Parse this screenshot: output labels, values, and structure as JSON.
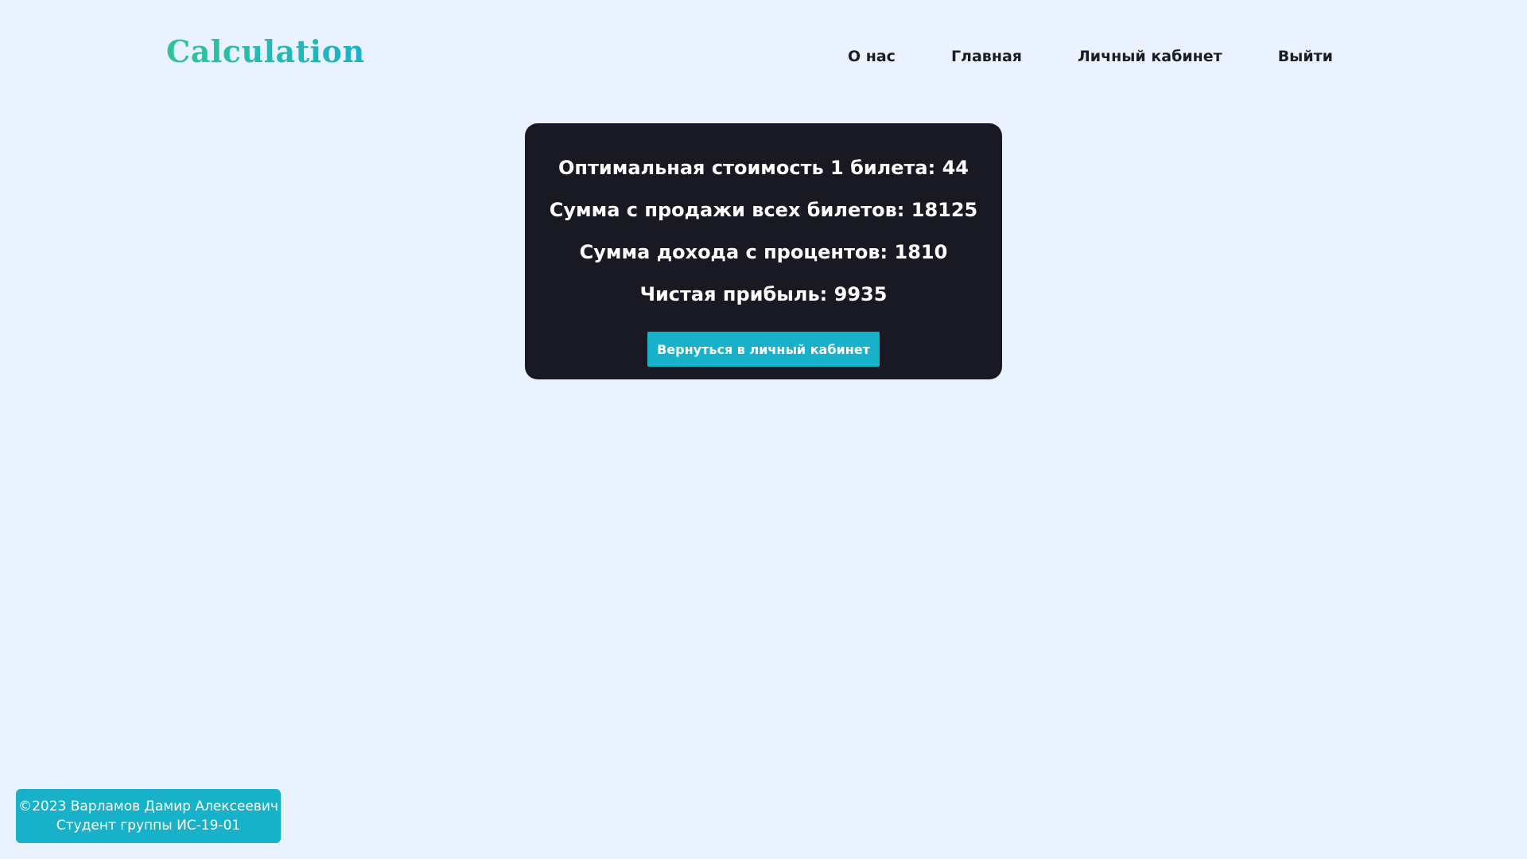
{
  "header": {
    "logo": "Calculation",
    "nav": [
      {
        "label": "О нас"
      },
      {
        "label": "Главная"
      },
      {
        "label": "Личный кабинет"
      },
      {
        "label": "Выйти"
      }
    ]
  },
  "result": {
    "lines": [
      "Оптимальная стоимость 1 билета: 44",
      "Сумма с продажи всех билетов: 18125",
      "Сумма дохода с процентов: 1810",
      "Чистая прибыль: 9935"
    ],
    "back_label": "Вернуться в личный кабинет"
  },
  "footer": {
    "line1": "©2023 Варламов Дамир Алексеевич",
    "line2": "Студент группы ИС-19-01"
  },
  "colors": {
    "background": "#eaf2ff",
    "card": "#191924",
    "accent": "#17b2c9",
    "logo_start": "#33c39a",
    "logo_end": "#17b2c9",
    "nav_text": "#1b1d25"
  }
}
